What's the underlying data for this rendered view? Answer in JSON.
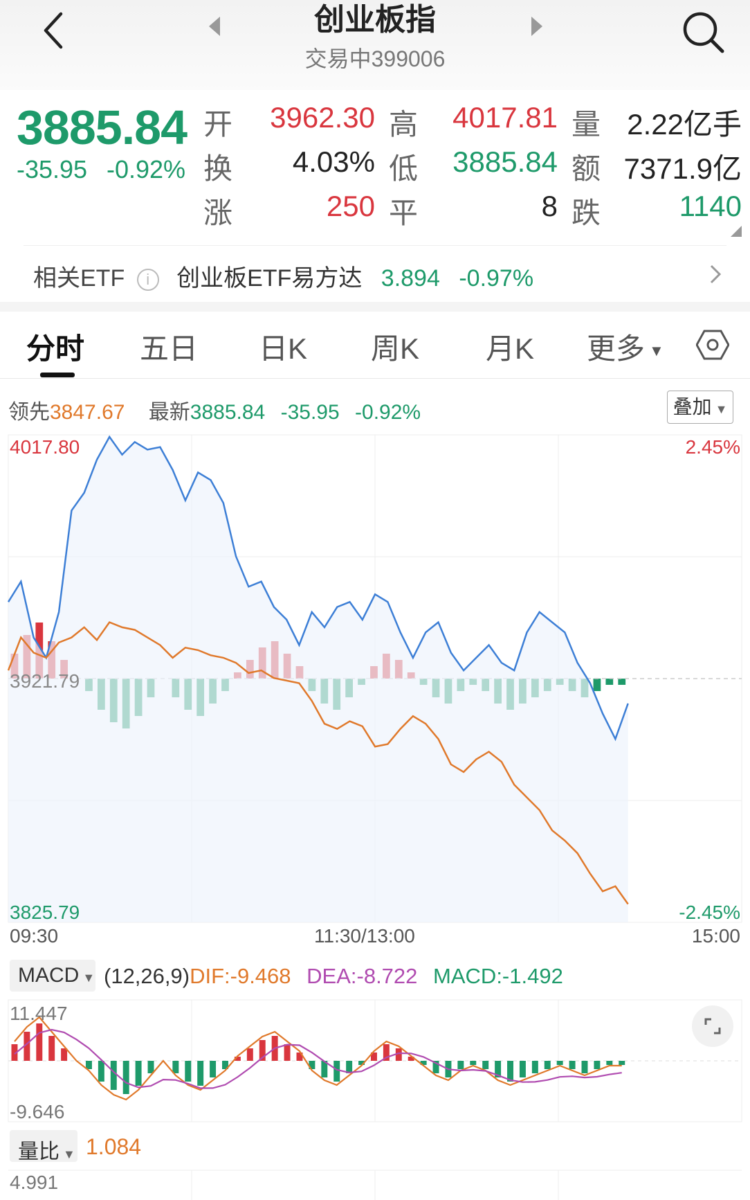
{
  "header": {
    "title": "创业板指",
    "status": "交易中",
    "code": "399006"
  },
  "quote": {
    "price": "3885.84",
    "change": "-35.95",
    "change_pct": "-0.92%",
    "fields": [
      {
        "label": "开",
        "value": "3962.30",
        "color": "red"
      },
      {
        "label": "高",
        "value": "4017.81",
        "color": "red"
      },
      {
        "label": "量",
        "value": "2.22亿手",
        "color": "dark"
      },
      {
        "label": "换",
        "value": "4.03%",
        "color": "dark"
      },
      {
        "label": "低",
        "value": "3885.84",
        "color": "green"
      },
      {
        "label": "额",
        "value": "7371.9亿",
        "color": "dark"
      },
      {
        "label": "涨",
        "value": "250",
        "color": "red"
      },
      {
        "label": "平",
        "value": "8",
        "color": "dark"
      },
      {
        "label": "跌",
        "value": "1140",
        "color": "green"
      }
    ]
  },
  "etf": {
    "label": "相关ETF",
    "name": "创业板ETF易方达",
    "price": "3.894",
    "change_pct": "-0.97%"
  },
  "tabs": [
    "分时",
    "五日",
    "日K",
    "周K",
    "月K",
    "更多"
  ],
  "active_tab": "分时",
  "legend": {
    "lead_label": "领先",
    "lead_value": "3847.67",
    "latest_label": "最新",
    "latest_value": "3885.84",
    "latest_change": "-35.95",
    "latest_pct": "-0.92%",
    "overlay_button": "叠加"
  },
  "axes": {
    "high": "4017.80",
    "high_pct": "2.45%",
    "low": "3825.79",
    "low_pct": "-2.45%",
    "prev_close": "3921.79",
    "time_labels": [
      "09:30",
      "11:30/13:00",
      "15:00"
    ]
  },
  "macd": {
    "selector": "MACD",
    "params": "(12,26,9)",
    "dif": "DIF:-9.468",
    "dea": "DEA:-8.722",
    "macd": "MACD:-1.492",
    "hi": "11.447",
    "lo": "-9.646"
  },
  "volume_ratio": {
    "selector": "量比",
    "value": "1.084",
    "hi": "4.991"
  },
  "colors": {
    "red": "#d9363e",
    "green": "#1e9a6a",
    "price_line": "#3d7fd6",
    "lead_line": "#e0792b",
    "dea_line": "#b04bb0"
  },
  "chart_data": [
    {
      "type": "line",
      "x_range": [
        "09:30",
        "15:00"
      ],
      "ylim": [
        3825.79,
        4017.8
      ],
      "reference": 3921.79,
      "series": [
        {
          "values": [
            3952,
            3960,
            3938,
            3930,
            3948,
            3988,
            3995,
            4008,
            4017,
            4010,
            4015,
            4012,
            4013,
            4004,
            3992,
            4003,
            4000,
            3991,
            3970,
            3958,
            3960,
            3950,
            3945,
            3935,
            3948,
            3942,
            3950,
            3952,
            3945,
            3955,
            3952,
            3940,
            3930,
            3940,
            3944,
            3932,
            3925,
            3930,
            3935,
            3928,
            3925,
            3940,
            3948,
            3944,
            3940,
            3928,
            3920,
            3908,
            3898,
            3912
          ]
        },
        {
          "values": [
            3925,
            3938,
            3932,
            3930,
            3936,
            3938,
            3942,
            3937,
            3944,
            3942,
            3941,
            3938,
            3935,
            3930,
            3934,
            3933,
            3931,
            3930,
            3928,
            3924,
            3925,
            3922,
            3921,
            3920,
            3913,
            3904,
            3902,
            3905,
            3903,
            3895,
            3896,
            3902,
            3907,
            3904,
            3898,
            3888,
            3885,
            3890,
            3893,
            3889,
            3880,
            3875,
            3870,
            3862,
            3858,
            3853,
            3845,
            3838,
            3840,
            3833
          ]
        }
      ]
    },
    {
      "type": "bar",
      "values": [
        4,
        7,
        9,
        6,
        3,
        0,
        -2,
        -5,
        -7,
        -8,
        -6,
        -3,
        0,
        -3,
        -5,
        -6,
        -4,
        -2,
        1,
        3,
        5,
        6,
        4,
        2,
        -2,
        -4,
        -5,
        -3,
        -1,
        2,
        4,
        3,
        1,
        -1,
        -3,
        -4,
        -2,
        -1,
        -2,
        -4,
        -5,
        -4,
        -3,
        -2,
        -1,
        -2,
        -3,
        -2,
        -1,
        -1
      ],
      "ylim": [
        -9.646,
        11.447
      ]
    }
  ]
}
